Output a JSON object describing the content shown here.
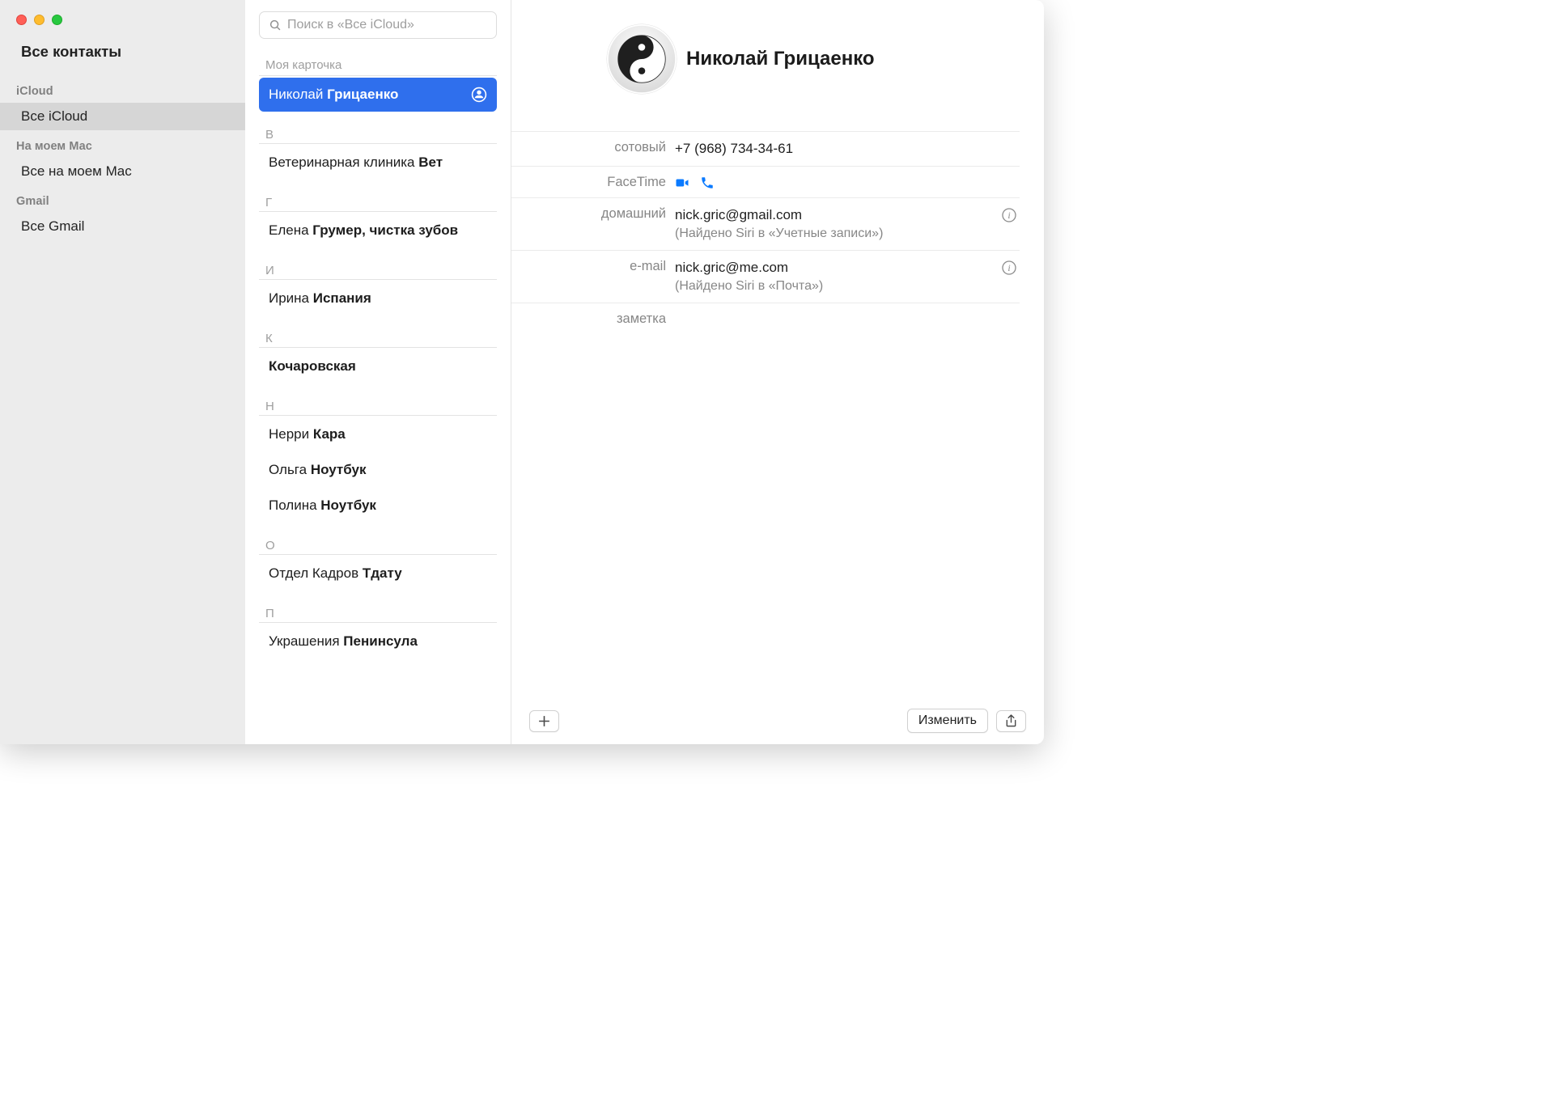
{
  "sidebar": {
    "title": "Все контакты",
    "groups": [
      {
        "header": "iCloud",
        "items": [
          {
            "label": "Все iCloud",
            "selected": true
          }
        ]
      },
      {
        "header": "На моем Mac",
        "items": [
          {
            "label": "Все на моем Mac",
            "selected": false
          }
        ]
      },
      {
        "header": "Gmail",
        "items": [
          {
            "label": "Все Gmail",
            "selected": false
          }
        ]
      }
    ]
  },
  "search": {
    "placeholder": "Поиск в «Все iCloud»"
  },
  "list": {
    "my_card_header": "Моя карточка",
    "me": {
      "first": "Николай ",
      "last": "Грицаенко",
      "selected": true
    },
    "sections": [
      {
        "letter": "В",
        "rows": [
          {
            "first": "Ветеринарная клиника ",
            "last": "Вет"
          }
        ]
      },
      {
        "letter": "Г",
        "rows": [
          {
            "first": "Елена ",
            "last": "Грумер, чистка зубов"
          }
        ]
      },
      {
        "letter": "И",
        "rows": [
          {
            "first": "Ирина ",
            "last": "Испания"
          }
        ]
      },
      {
        "letter": "К",
        "rows": [
          {
            "first": "",
            "last": "Кочаровская"
          }
        ]
      },
      {
        "letter": "Н",
        "rows": [
          {
            "first": "Нерри ",
            "last": "Кара"
          },
          {
            "first": "Ольга ",
            "last": "Ноутбук"
          },
          {
            "first": "Полина ",
            "last": "Ноутбук"
          }
        ]
      },
      {
        "letter": "О",
        "rows": [
          {
            "first": "Отдел Кадров ",
            "last": "Тдату"
          }
        ]
      },
      {
        "letter": "П",
        "rows": [
          {
            "first": "Украшения ",
            "last": "Пенинсула"
          }
        ]
      }
    ]
  },
  "detail": {
    "name": "Николай Грицаенко",
    "fields": {
      "mobile": {
        "label": "сотовый",
        "value": "+7 (968) 734-34-61"
      },
      "facetime": {
        "label": "FaceTime"
      },
      "home": {
        "label": "домашний",
        "value": "nick.gric@gmail.com",
        "sub": "(Найдено Siri в «Учетные записи»)"
      },
      "email": {
        "label": "e-mail",
        "value": "nick.gric@me.com",
        "sub": "(Найдено Siri в «Почта»)"
      },
      "note": {
        "label": "заметка",
        "value": ""
      }
    }
  },
  "buttons": {
    "edit": "Изменить"
  },
  "colors": {
    "accent": "#2f6fed",
    "facetime": "#0a7aff"
  }
}
